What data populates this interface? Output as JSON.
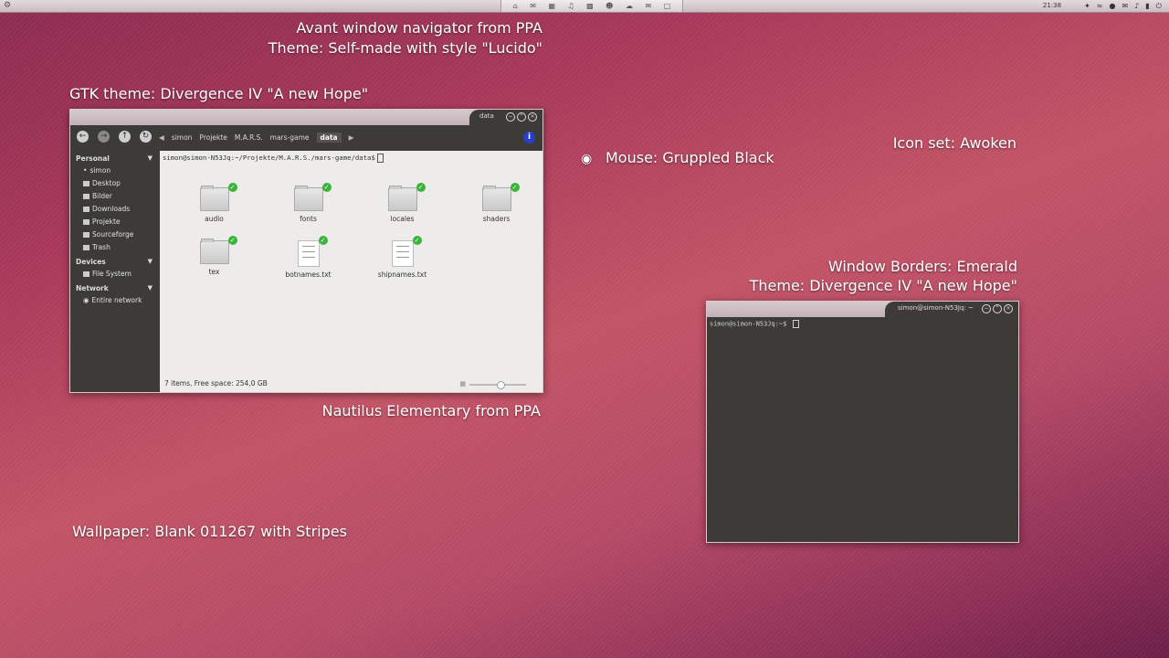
{
  "panel": {
    "clock": "21:38",
    "dock_icons": [
      "home-icon",
      "mail-icon",
      "grid-icon",
      "headphones-icon",
      "apps-icon",
      "chat-icon",
      "cloud-icon",
      "email-icon",
      "window-icon"
    ],
    "indicators": [
      "dropbox-icon",
      "wifi-icon",
      "network-icon",
      "messaging-icon",
      "volume-icon",
      "battery-icon",
      "power-icon"
    ]
  },
  "annotations": {
    "avant": "Avant window navigator from PPA",
    "theme_lucido": "Theme: Self-made with style \"Lucido\"",
    "gtk": "GTK theme: Divergence IV \"A new Hope\"",
    "mouse": "Mouse: Gruppled Black",
    "iconset": "Icon set: Awoken",
    "borders": "Window Borders: Emerald",
    "borders_theme": "Theme: Divergence IV \"A new Hope\"",
    "nautilus": "Nautilus Elementary from PPA",
    "wallpaper": "Wallpaper: Blank 011267 with Stripes"
  },
  "nautilus": {
    "title": "data",
    "breadcrumbs": [
      "simon",
      "Projekte",
      "M.A.R.S.",
      "mars-game",
      "data"
    ],
    "path": "simon@simon-N53Jq:~/Projekte/M.A.R.S./mars-game/data$",
    "sidebar": {
      "personal_header": "Personal",
      "personal": [
        "simon",
        "Desktop",
        "Bilder",
        "Downloads",
        "Projekte",
        "Sourceforge",
        "Trash"
      ],
      "devices_header": "Devices",
      "devices": [
        "File System"
      ],
      "network_header": "Network",
      "network": [
        "Entire network"
      ]
    },
    "files": [
      {
        "name": "audio",
        "kind": "folder"
      },
      {
        "name": "fonts",
        "kind": "folder"
      },
      {
        "name": "locales",
        "kind": "folder"
      },
      {
        "name": "shaders",
        "kind": "folder"
      },
      {
        "name": "tex",
        "kind": "folder"
      },
      {
        "name": "botnames.txt",
        "kind": "text"
      },
      {
        "name": "shipnames.txt",
        "kind": "text"
      }
    ],
    "status": "7 items, Free space: 254,0 GB",
    "zoom_level": 0.55
  },
  "terminal": {
    "title": "simon@simon-N53Jq: ~",
    "prompt": "simon@simon-N53Jq:~$"
  }
}
